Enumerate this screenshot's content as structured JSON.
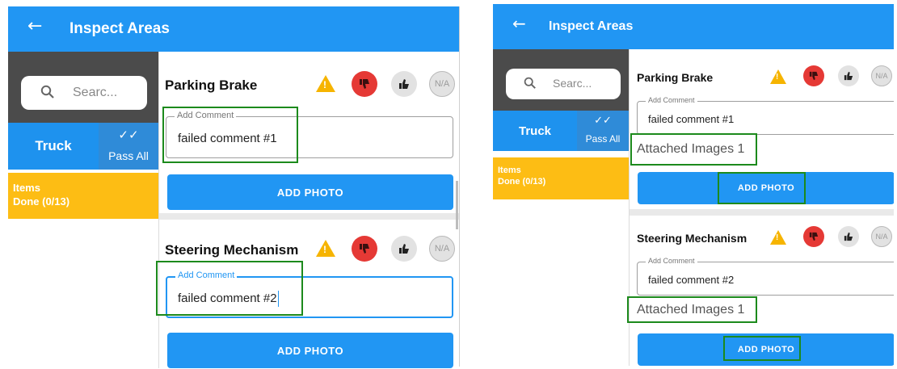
{
  "appbar": {
    "title": "Inspect Areas",
    "back_glyph": "←"
  },
  "search": {
    "placeholder_left": "Searc...",
    "placeholder_right": "Searc...",
    "icon": "search-icon"
  },
  "tabs": {
    "truck_label": "Truck",
    "pass_all_label": "Pass All",
    "pass_all_icon": "double-check-icon"
  },
  "items": {
    "line1": "Items",
    "line2": "Done (0/13)"
  },
  "inspection_items": [
    {
      "title": "Parking Brake",
      "comment_label": "Add Comment",
      "comment_value": "failed comment #1",
      "attached_images": "Attached Images 1"
    },
    {
      "title": "Steering Mechanism",
      "comment_label": "Add Comment",
      "comment_value": "failed comment #2",
      "attached_images": "Attached Images 1"
    }
  ],
  "status_buttons": {
    "na_label": "N/A"
  },
  "add_photo_label": "ADD PHOTO",
  "colors": {
    "primary": "#2196f3",
    "fail": "#e53935",
    "warning": "#f6b400",
    "items_bg": "#fdbd14",
    "highlight": "#1c8a1c"
  }
}
